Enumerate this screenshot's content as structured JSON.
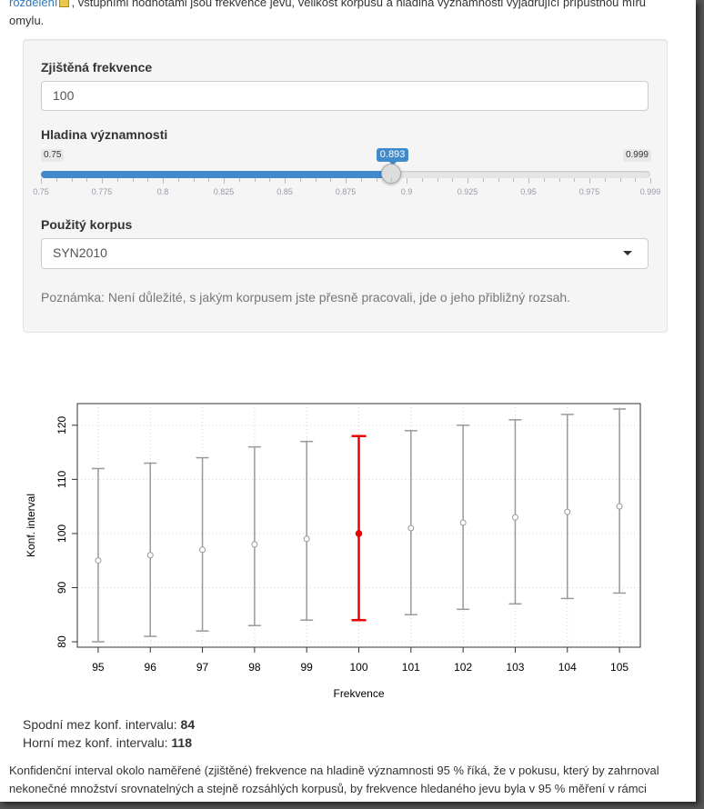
{
  "intro": {
    "link_text": "rozdělení",
    "text_after": ", vstupními hodnotami jsou frekvence jevu, velikost korpusu a hladina významnosti vyjadřující přípustnou míru omylu."
  },
  "form": {
    "frequency": {
      "label": "Zjištěná frekvence",
      "value": "100"
    },
    "significance": {
      "label": "Hladina významnosti",
      "min_label": "0.75",
      "max_label": "0.999",
      "value_label": "0.893",
      "value": 0.893,
      "min": 0.75,
      "max": 0.999,
      "tick_labels": [
        "0.75",
        "0.775",
        "0.8",
        "0.825",
        "0.85",
        "0.875",
        "0.9",
        "0.925",
        "0.95",
        "0.975",
        "0.999"
      ]
    },
    "corpus": {
      "label": "Použitý korpus",
      "selected": "SYN2010"
    },
    "note": "Poznámka: Není důležité, s jakým korpusem jste přesně pracovali, jde o jeho přibližný rozsah."
  },
  "chart_data": {
    "type": "scatter",
    "xlabel": "Frekvence",
    "ylabel": "Konf. interval",
    "x": [
      95,
      96,
      97,
      98,
      99,
      100,
      101,
      102,
      103,
      104,
      105
    ],
    "y": [
      95,
      96,
      97,
      98,
      99,
      100,
      101,
      102,
      103,
      104,
      105
    ],
    "lower": [
      80,
      81,
      82,
      83,
      84,
      84,
      85,
      86,
      87,
      88,
      89
    ],
    "upper": [
      112,
      113,
      114,
      116,
      117,
      118,
      119,
      120,
      121,
      122,
      123
    ],
    "highlight_x": 100,
    "highlight_color": "#ee0000",
    "series_color": "#999999",
    "xlim": [
      94.6,
      105.4
    ],
    "ylim": [
      79,
      124
    ],
    "yticks": [
      80,
      90,
      100,
      110,
      120
    ],
    "grid": true
  },
  "results": {
    "lower_label": "Spodní mez konf. intervalu:",
    "lower_value": "84",
    "upper_label": "Horní mez konf. intervalu:",
    "upper_value": "118"
  },
  "bottom_text": "Konfidenční interval okolo naměřené (zjištěné) frekvence na hladině významnosti 95 % říká, že v pokusu, který by zahrnoval nekonečné množství srovnatelných a stejně rozsáhlých korpusů, by frekvence hledaného jevu byla v 95 % měření v rámci"
}
